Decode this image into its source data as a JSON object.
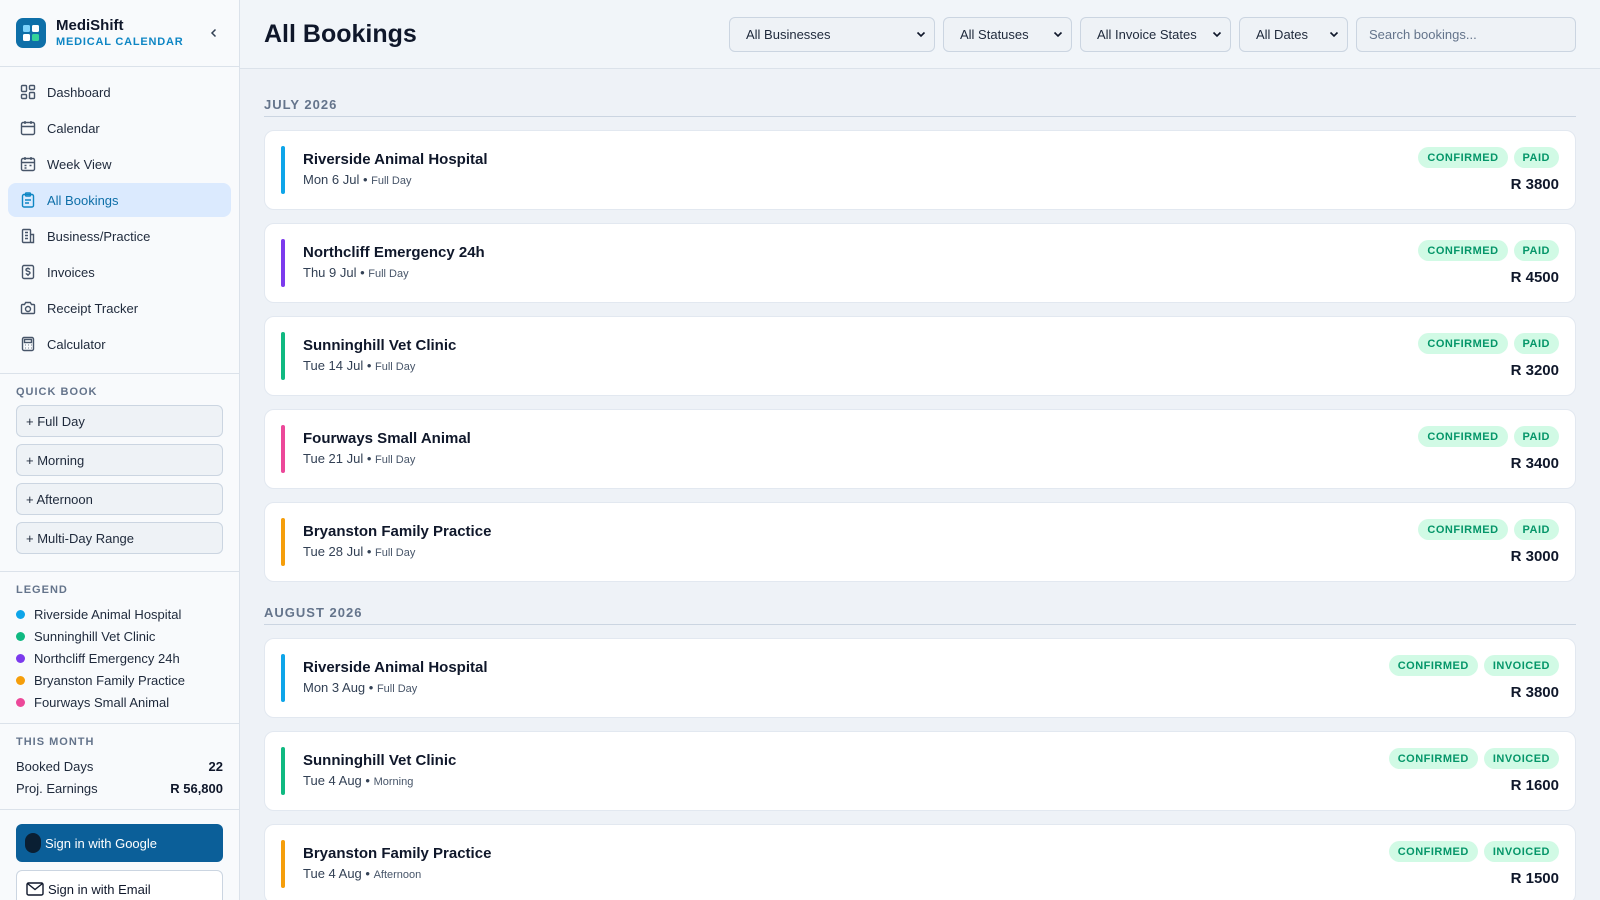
{
  "brand": {
    "name": "MediShift",
    "subtitle": "MEDICAL CALENDAR",
    "logo_icon": "medical-cross-icon"
  },
  "nav": [
    {
      "label": "Dashboard",
      "icon": "dashboard-icon",
      "active": false
    },
    {
      "label": "Calendar",
      "icon": "calendar-icon",
      "active": false
    },
    {
      "label": "Week View",
      "icon": "week-icon",
      "active": false
    },
    {
      "label": "All Bookings",
      "icon": "clipboard-icon",
      "active": true
    },
    {
      "label": "Business/Practice",
      "icon": "building-icon",
      "active": false
    },
    {
      "label": "Invoices",
      "icon": "invoice-icon",
      "active": false
    },
    {
      "label": "Receipt Tracker",
      "icon": "camera-icon",
      "active": false
    },
    {
      "label": "Calculator",
      "icon": "calculator-icon",
      "active": false
    }
  ],
  "quick_book": {
    "title": "QUICK BOOK",
    "buttons": [
      "+ Full Day",
      "+ Morning",
      "+ Afternoon",
      "+ Multi-Day Range"
    ]
  },
  "legend": {
    "title": "LEGEND",
    "items": [
      {
        "label": "Riverside Animal Hospital",
        "color": "#0ea5e9"
      },
      {
        "label": "Sunninghill Vet Clinic",
        "color": "#10b981"
      },
      {
        "label": "Northcliff Emergency 24h",
        "color": "#7c3aed"
      },
      {
        "label": "Bryanston Family Practice",
        "color": "#f59e0b"
      },
      {
        "label": "Fourways Small Animal",
        "color": "#ec4899"
      }
    ]
  },
  "this_month": {
    "title": "THIS MONTH",
    "booked_days_label": "Booked Days",
    "booked_days_value": "22",
    "earnings_label": "Proj. Earnings",
    "earnings_value": "R 56,800"
  },
  "auth": {
    "google_label": "Sign in with Google",
    "email_label": "Sign in with Email"
  },
  "header": {
    "title": "All Bookings",
    "filters": [
      "All Businesses",
      "All Statuses",
      "All Invoice States",
      "All Dates"
    ],
    "search_placeholder": "Search bookings..."
  },
  "months": [
    {
      "label": "JULY 2026",
      "bookings": [
        {
          "business": "Riverside Animal Hospital",
          "date": "Mon 6 Jul",
          "slot": "Full Day",
          "status": "CONFIRMED",
          "invoice": "PAID",
          "amount": "R 3800",
          "color": "#0ea5e9"
        },
        {
          "business": "Northcliff Emergency 24h",
          "date": "Thu 9 Jul",
          "slot": "Full Day",
          "status": "CONFIRMED",
          "invoice": "PAID",
          "amount": "R 4500",
          "color": "#7c3aed"
        },
        {
          "business": "Sunninghill Vet Clinic",
          "date": "Tue 14 Jul",
          "slot": "Full Day",
          "status": "CONFIRMED",
          "invoice": "PAID",
          "amount": "R 3200",
          "color": "#10b981"
        },
        {
          "business": "Fourways Small Animal",
          "date": "Tue 21 Jul",
          "slot": "Full Day",
          "status": "CONFIRMED",
          "invoice": "PAID",
          "amount": "R 3400",
          "color": "#ec4899"
        },
        {
          "business": "Bryanston Family Practice",
          "date": "Tue 28 Jul",
          "slot": "Full Day",
          "status": "CONFIRMED",
          "invoice": "PAID",
          "amount": "R 3000",
          "color": "#f59e0b"
        }
      ]
    },
    {
      "label": "AUGUST 2026",
      "bookings": [
        {
          "business": "Riverside Animal Hospital",
          "date": "Mon 3 Aug",
          "slot": "Full Day",
          "status": "CONFIRMED",
          "invoice": "INVOICED",
          "amount": "R 3800",
          "color": "#0ea5e9"
        },
        {
          "business": "Sunninghill Vet Clinic",
          "date": "Tue 4 Aug",
          "slot": "Morning",
          "status": "CONFIRMED",
          "invoice": "INVOICED",
          "amount": "R 1600",
          "color": "#10b981"
        },
        {
          "business": "Bryanston Family Practice",
          "date": "Tue 4 Aug",
          "slot": "Afternoon",
          "status": "CONFIRMED",
          "invoice": "INVOICED",
          "amount": "R 1500",
          "color": "#f59e0b"
        }
      ]
    }
  ]
}
